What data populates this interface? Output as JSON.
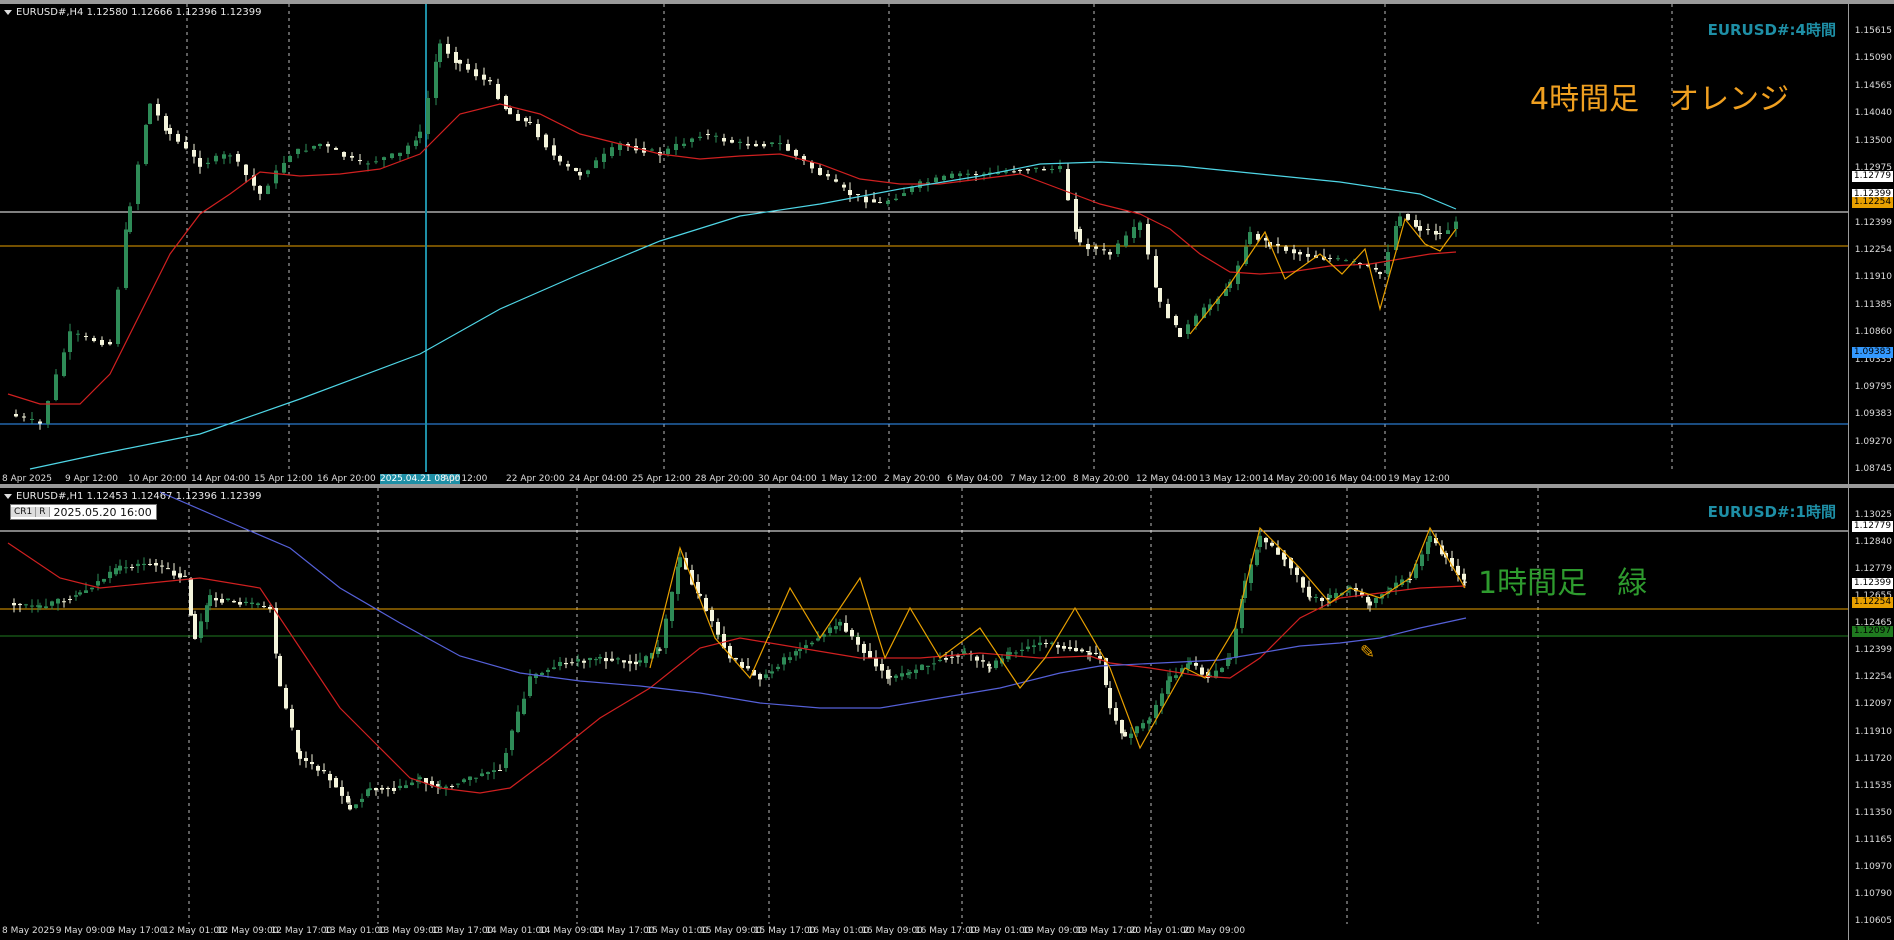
{
  "top_chart": {
    "header": "EURUSD#,H4  1.12580 1.12666 1.12396 1.12399",
    "symbol_title": "EURUSD#:4時間",
    "jp_label": "4時間足　オレンジ",
    "jp_label_color": "#f0a020",
    "price_labels": [
      "1.15615",
      "1.15090",
      "1.14565",
      "1.14040",
      "1.13500",
      "1.12975",
      "1.12779",
      "1.12399",
      "1.12254",
      "1.11910",
      "1.11385",
      "1.10860",
      "1.10335",
      "1.09795",
      "1.09383",
      "1.09270",
      "1.08745"
    ],
    "tags": [
      {
        "text": "1.12779",
        "bg": "#ffffff",
        "fg": "#000000"
      },
      {
        "text": "1.12399",
        "bg": "#ffffff",
        "fg": "#000000"
      },
      {
        "text": "1.12254",
        "bg": "#e8a000",
        "fg": "#000000"
      },
      {
        "text": "1.09383",
        "bg": "#3399ff",
        "fg": "#000000"
      }
    ],
    "time_labels": [
      "8 Apr 2025",
      "9 Apr 12:00",
      "10 Apr 20:00",
      "14 Apr 04:00",
      "15 Apr 12:00",
      "16 Apr 20:00",
      "2025.04.21 08:00",
      "Apr 12:00",
      "22 Apr 20:00",
      "24 Apr 04:00",
      "25 Apr 12:00",
      "28 Apr 20:00",
      "30 Apr 04:00",
      "1 May 12:00",
      "2 May 20:00",
      "6 May 04:00",
      "7 May 12:00",
      "8 May 20:00",
      "12 May 04:00",
      "13 May 12:00",
      "14 May 20:00",
      "16 May 04:00",
      "19 May 12:00"
    ],
    "highlighted_date": "2025.04.21 08:00"
  },
  "bottom_chart": {
    "header": "EURUSD#,H1  1.12453 1.12467 1.12396 1.12399",
    "symbol_title": "EURUSD#:1時間",
    "jp_label": "1時間足　緑",
    "jp_label_color": "#2e9b2e",
    "crosshair": {
      "btn1": "CR1",
      "btn2": "R",
      "datetime": "2025.05.20 16:00"
    },
    "price_labels": [
      "1.13025",
      "1.12840",
      "1.12779",
      "1.12655",
      "1.12465",
      "1.12399",
      "1.12254",
      "1.12097",
      "1.11910",
      "1.11720",
      "1.11535",
      "1.11350",
      "1.11165",
      "1.10970",
      "1.10790",
      "1.10605"
    ],
    "tags": [
      {
        "text": "1.12779",
        "bg": "#ffffff",
        "fg": "#000000"
      },
      {
        "text": "1.12399",
        "bg": "#ffffff",
        "fg": "#000000"
      },
      {
        "text": "1.12254",
        "bg": "#e8a000",
        "fg": "#000000"
      },
      {
        "text": "1.12097",
        "bg": "#1f7a1f",
        "fg": "#000000"
      }
    ],
    "time_labels": [
      "8 May 2025",
      "9 May 09:00",
      "9 May 17:00",
      "12 May 01:00",
      "12 May 09:00",
      "12 May 17:00",
      "13 May 01:00",
      "13 May 09:00",
      "13 May 17:00",
      "14 May 01:00",
      "14 May 09:00",
      "14 May 17:00",
      "15 May 01:00",
      "15 May 09:00",
      "15 May 17:00",
      "16 May 01:00",
      "16 May 09:00",
      "16 May 17:00",
      "19 May 01:00",
      "19 May 09:00",
      "19 May 17:00",
      "20 May 01:00",
      "20 May 09:00"
    ]
  }
}
